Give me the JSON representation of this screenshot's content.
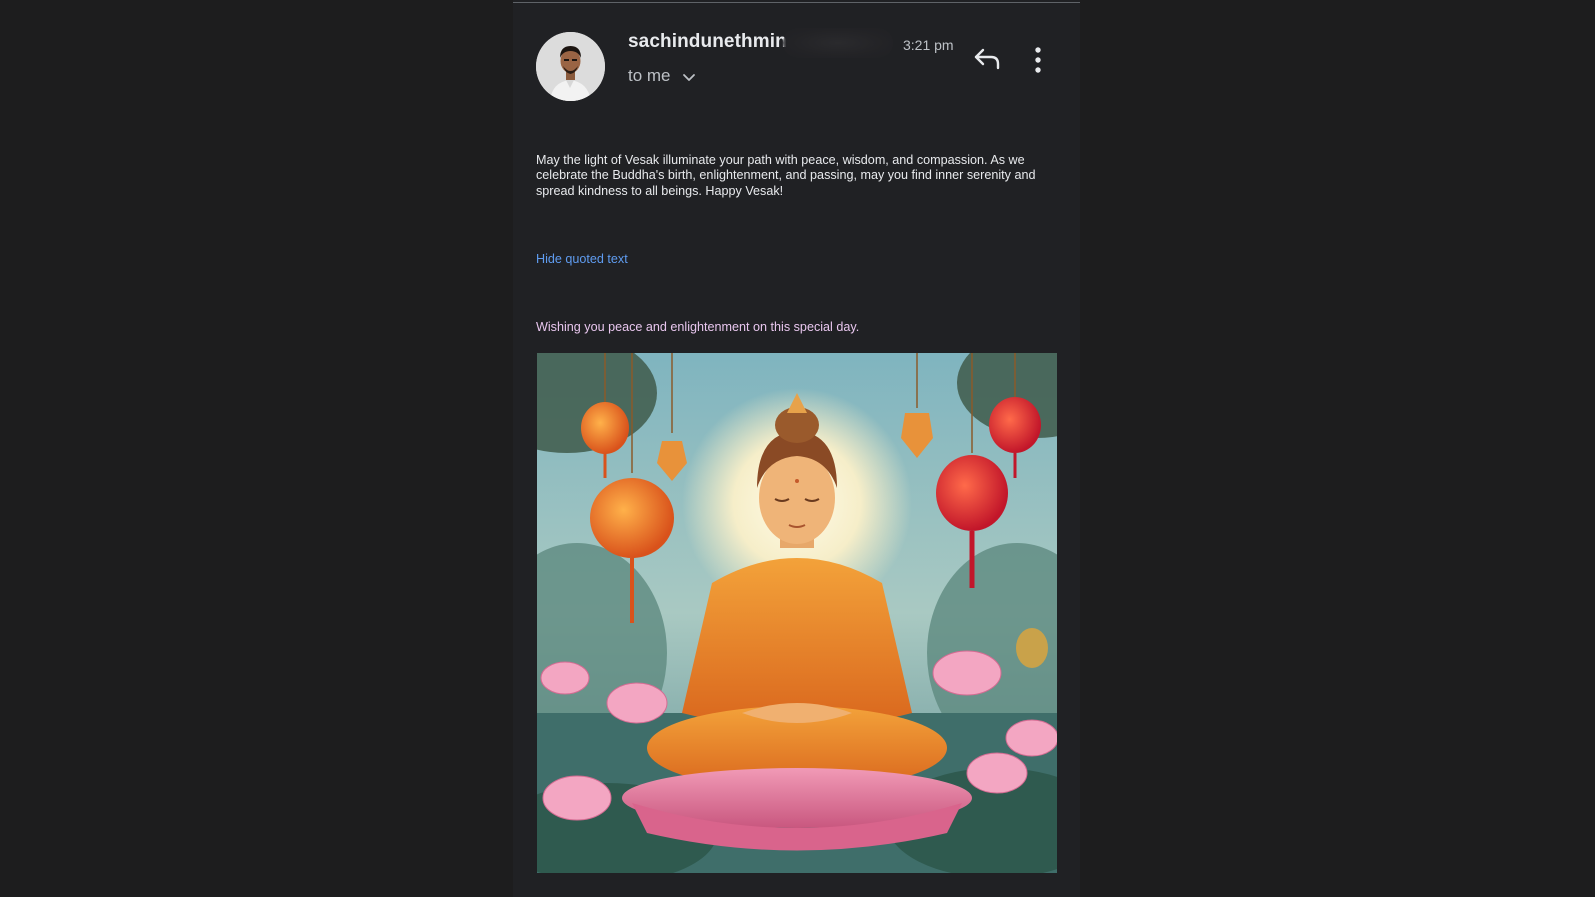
{
  "email": {
    "sender": "sachindunethmin",
    "time": "3:21 pm",
    "recipient_label": "to me",
    "body": "May the light of Vesak illuminate your path with peace, wisdom, and compassion. As we celebrate the Buddha's birth, enlightenment, and passing, may you find inner serenity and spread kindness to all beings. Happy Vesak!",
    "hide_quoted_label": "Hide quoted text",
    "quoted_text": "Wishing you peace and enlightenment on this special day."
  },
  "icons": {
    "details": "chevron-down-icon",
    "reply": "reply-icon",
    "more": "more-vert-icon"
  },
  "colors": {
    "background": "#202124",
    "link": "#5f9cf0",
    "quoted_text": "#e8c6ee"
  }
}
